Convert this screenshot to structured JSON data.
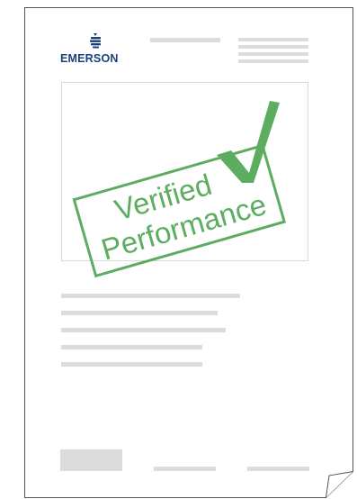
{
  "brand": {
    "name": "EMERSON",
    "color": "#1a3f7a",
    "mark_icon": "emerson-logo-mark-icon"
  },
  "stamp": {
    "line1": "Verified",
    "line2": "Performance",
    "color": "#5cad5f",
    "check_icon": "checkmark-icon"
  },
  "colors": {
    "placeholder_line": "#dcdcdc",
    "page_border": "#555555",
    "frame_border": "#d9d9d9"
  }
}
